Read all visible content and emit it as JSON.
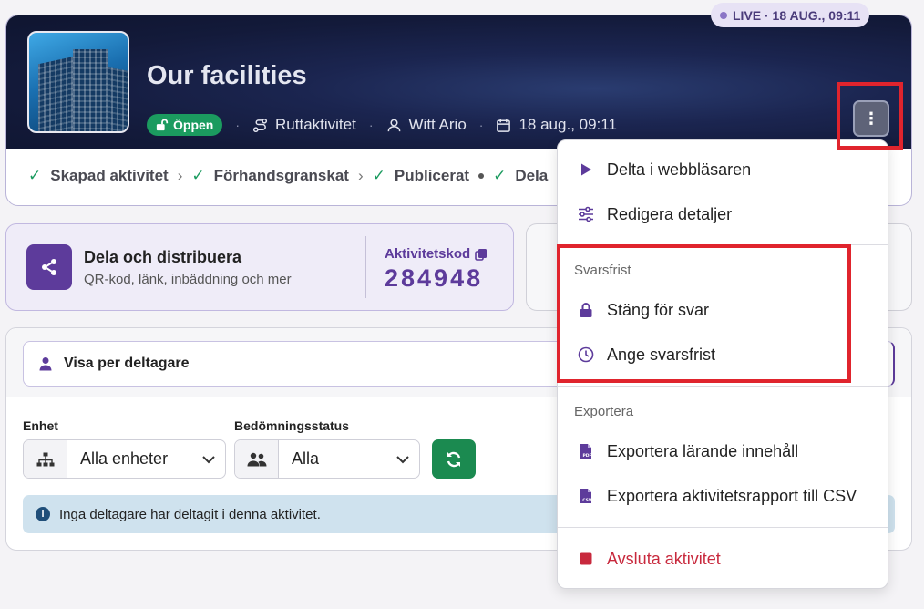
{
  "live_pill": "LIVE · 18 AUG., 09:11",
  "header": {
    "title": "Our facilities",
    "status": "Öppen",
    "activity_type": "Ruttaktivitet",
    "owner": "Witt Ario",
    "date": "18 aug., 09:11"
  },
  "steps": [
    {
      "label": "Skapad aktivitet"
    },
    {
      "label": "Förhandsgranskat"
    },
    {
      "label": "Publicerat"
    },
    {
      "label": "Dela"
    }
  ],
  "share": {
    "title": "Dela och distribuera",
    "subtitle": "QR-kod, länk, inbäddning och mer",
    "code_label": "Aktivitetskod",
    "code": "284948"
  },
  "participants": {
    "view_label": "Visa per deltagare",
    "unit_label": "Enhet",
    "unit_value": "Alla enheter",
    "status_label": "Bedömningsstatus",
    "status_value": "Alla",
    "info": "Inga deltagare har deltagit i denna aktivitet."
  },
  "menu": {
    "play": "Delta i webbläsaren",
    "edit": "Redigera detaljer",
    "deadline_header": "Svarsfrist",
    "close": "Stäng för svar",
    "set_deadline": "Ange svarsfrist",
    "export_header": "Exportera",
    "export_content": "Exportera lärande innehåll",
    "export_csv": "Exportera aktivitetsrapport till CSV",
    "end": "Avsluta aktivitet"
  },
  "colors": {
    "brand_purple": "#5d3b9b",
    "success_green": "#1b9b5f",
    "danger_red": "#c8293d",
    "highlight_red": "#e0242d"
  }
}
